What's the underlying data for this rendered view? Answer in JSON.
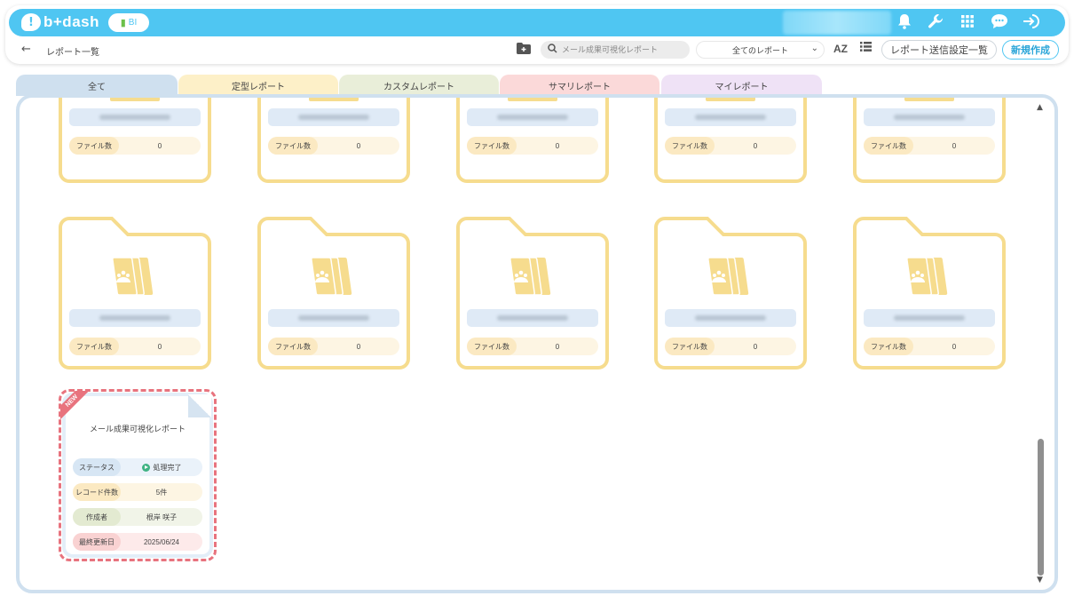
{
  "app": {
    "logo_text": "b+dash",
    "bi_badge": "BI"
  },
  "header": {
    "breadcrumb": "レポート一覧",
    "search_placeholder": "メール成果可視化レポート",
    "filter_selected": "全てのレポート",
    "sort_label": "AZ",
    "send_settings_label": "レポート送信設定一覧",
    "new_label": "新規作成"
  },
  "icons": {
    "bell": "bell-icon",
    "wrench": "wrench-icon",
    "apps": "apps-grid-icon",
    "chat": "chat-icon",
    "logout": "logout-icon"
  },
  "tabs": [
    {
      "label": "全て",
      "color": "#cfe0ef"
    },
    {
      "label": "定型レポート",
      "color": "#fdf0c8"
    },
    {
      "label": "カスタムレポート",
      "color": "#e9eed9"
    },
    {
      "label": "サマリレポート",
      "color": "#fbd9d9"
    },
    {
      "label": "マイレポート",
      "color": "#efe2f6"
    }
  ],
  "folders": [
    {
      "count_label": "ファイル数",
      "count": "0"
    },
    {
      "count_label": "ファイル数",
      "count": "0"
    },
    {
      "count_label": "ファイル数",
      "count": "0"
    },
    {
      "count_label": "ファイル数",
      "count": "0"
    },
    {
      "count_label": "ファイル数",
      "count": "0"
    },
    {
      "count_label": "ファイル数",
      "count": "0"
    },
    {
      "count_label": "ファイル数",
      "count": "0"
    },
    {
      "count_label": "ファイル数",
      "count": "0"
    },
    {
      "count_label": "ファイル数",
      "count": "0"
    },
    {
      "count_label": "ファイル数",
      "count": "0"
    }
  ],
  "report": {
    "badge": "NEW",
    "title": "メール成果可視化レポート",
    "status_label": "ステータス",
    "status_value": "処理完了",
    "records_label": "レコード件数",
    "records_value": "5件",
    "author_label": "作成者",
    "author_value": "根岸 咲子",
    "updated_label": "最終更新日",
    "updated_value": "2025/06/24"
  },
  "colors": {
    "brand": "#4fc6f2",
    "folder_border": "#f6dc8e",
    "folder_icon": "#f6dc8e",
    "highlight_dash": "#e8737e"
  }
}
